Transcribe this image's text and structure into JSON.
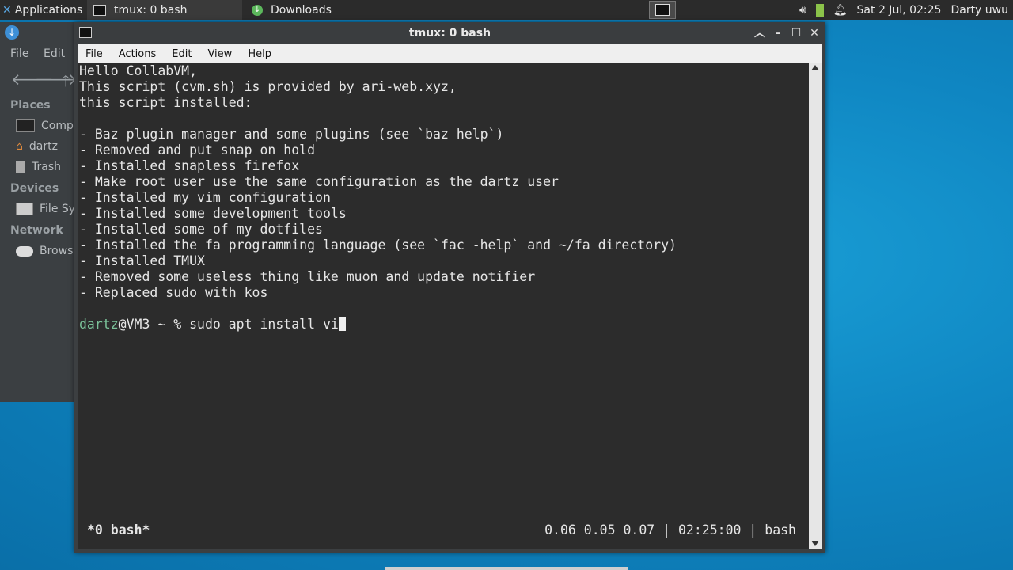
{
  "panel": {
    "apps_label": "Applications",
    "tasks": [
      {
        "label": "tmux: 0 bash"
      },
      {
        "label": "Downloads"
      }
    ],
    "datetime": "Sat  2 Jul, 02:25",
    "user": "Darty uwu"
  },
  "file_manager": {
    "menu": [
      "File",
      "Edit"
    ],
    "sections": {
      "places": "Places",
      "devices": "Devices",
      "network": "Network"
    },
    "items": {
      "computer": "Compu",
      "home": "dartz",
      "trash": "Trash",
      "filesystem": "File Sy",
      "browse": "Browse"
    }
  },
  "terminal": {
    "title": "tmux: 0 bash",
    "menu": [
      "File",
      "Actions",
      "Edit",
      "View",
      "Help"
    ],
    "lines": [
      "Hello CollabVM,",
      "This script (cvm.sh) is provided by ari-web.xyz,",
      "this script installed:",
      "",
      "- Baz plugin manager and some plugins (see `baz help`)",
      "- Removed and put snap on hold",
      "- Installed snapless firefox",
      "- Make root user use the same configuration as the dartz user",
      "- Installed my vim configuration",
      "- Installed some development tools",
      "- Installed some of my dotfiles",
      "- Installed the fa programming language (see `fac -help` and ~/fa directory)",
      "- Installed TMUX",
      "- Removed some useless thing like muon and update notifier",
      "- Replaced sudo with kos",
      ""
    ],
    "prompt_user": "dartz",
    "prompt_rest": "@VM3 ~ % ",
    "command": "sudo apt install vi",
    "status_left": "*0 bash*",
    "status_right": "0.06 0.05 0.07 | 02:25:00 | bash"
  },
  "colors": {
    "desktop": "#0f86c2",
    "terminal_bg": "#2c2c2c",
    "prompt_user": "#7bc39a"
  }
}
